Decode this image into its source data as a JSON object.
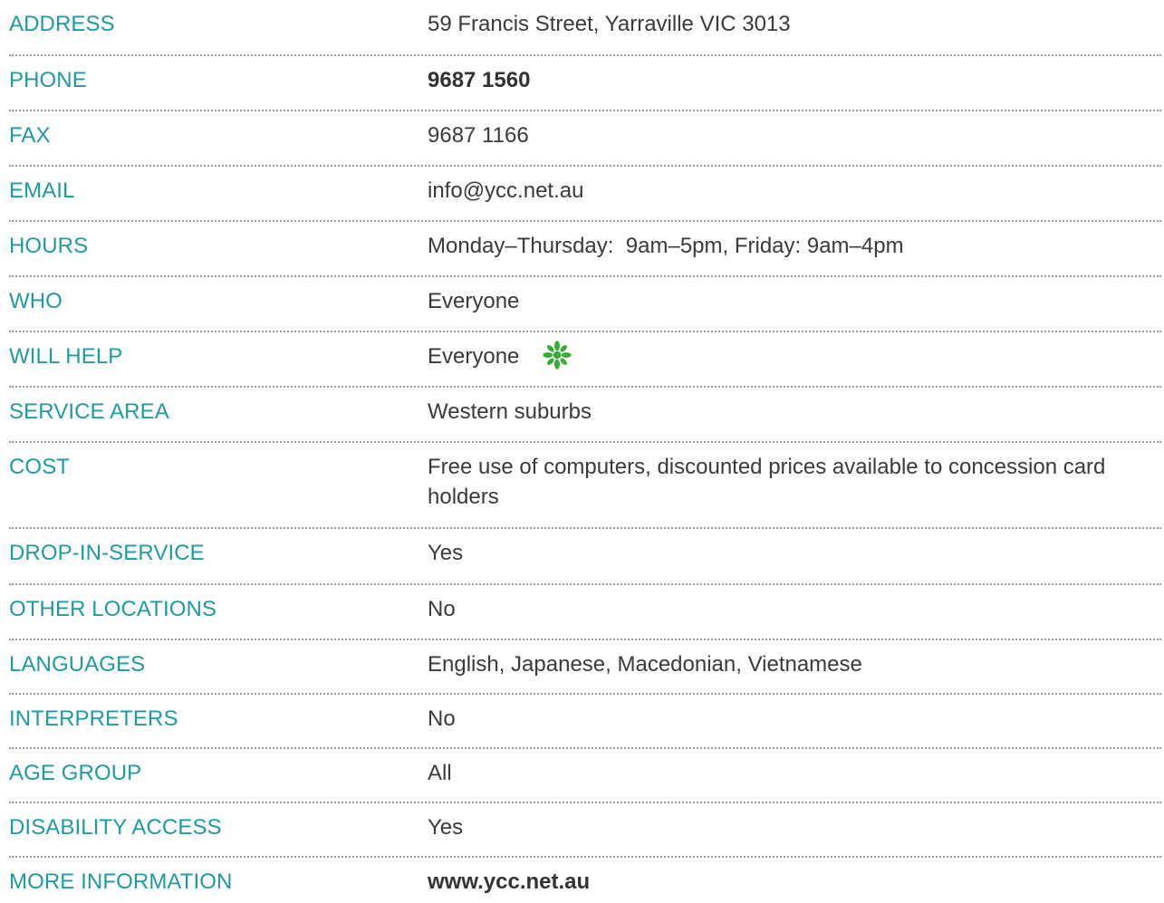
{
  "rows": [
    {
      "label": "ADDRESS",
      "value": "59 Francis Street, Yarraville VIC 3013"
    },
    {
      "label": "PHONE",
      "value": "9687 1560"
    },
    {
      "label": "FAX",
      "value": "9687 1166"
    },
    {
      "label": "EMAIL",
      "value": "info@ycc.net.au"
    },
    {
      "label": "HOURS",
      "value": "Monday–Thursday:  9am–5pm, Friday: 9am–4pm"
    },
    {
      "label": "WHO",
      "value": "Everyone"
    },
    {
      "label": "WILL HELP",
      "value": "Everyone",
      "icon": "green-star-icon"
    },
    {
      "label": "SERVICE AREA",
      "value": "Western suburbs"
    },
    {
      "label": "COST",
      "value": "Free use of computers, discounted prices available to concession card holders"
    },
    {
      "label": "DROP-IN-SERVICE",
      "value": "Yes"
    },
    {
      "label": "OTHER LOCATIONS",
      "value": "No"
    },
    {
      "label": "LANGUAGES",
      "value": "English, Japanese, Macedonian, Vietnamese"
    },
    {
      "label": "INTERPRETERS",
      "value": "No"
    },
    {
      "label": "AGE GROUP",
      "value": "All"
    },
    {
      "label": "DISABILITY ACCESS",
      "value": "Yes"
    },
    {
      "label": "MORE INFORMATION",
      "value": "www.ycc.net.au"
    }
  ],
  "colors": {
    "label": "#1e9aa3",
    "value": "#3a3a3a",
    "divider": "#9a9a9a",
    "icon": "#3aab35"
  }
}
